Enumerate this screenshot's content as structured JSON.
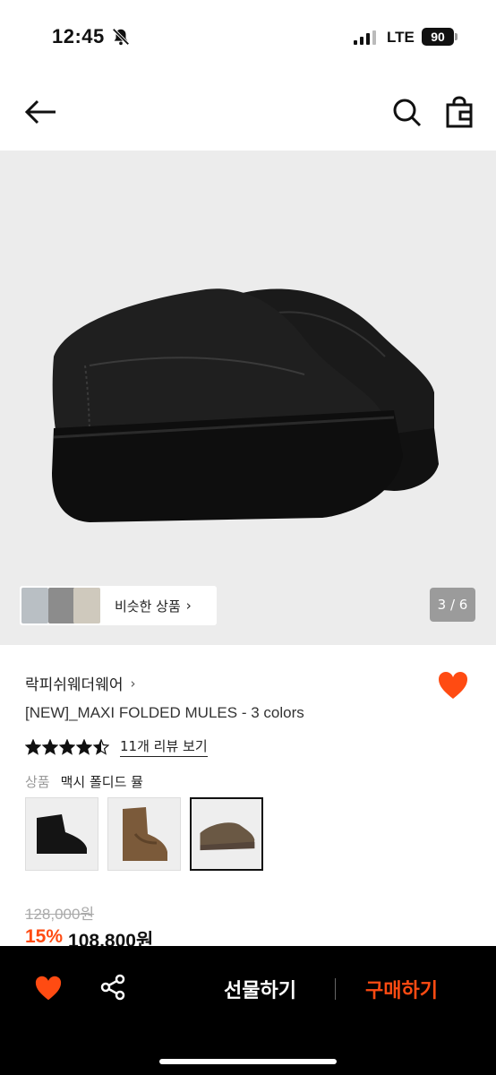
{
  "status_bar": {
    "time": "12:45",
    "network": "LTE",
    "battery": "90"
  },
  "gallery": {
    "similar_label": "비슷한 상품",
    "page_indicator": "3 / 6"
  },
  "product": {
    "brand": "락피쉬웨더웨어",
    "title": "[NEW]_MAXI FOLDED MULES - 3 colors",
    "rating": 4.5,
    "review_link": "11개 리뷰 보기",
    "option_key": "상품",
    "option_value": "맥시 폴디드 뮬",
    "original_price": "128,000원",
    "discount": "15%",
    "sale_price": "108,800원"
  },
  "bottom_bar": {
    "gift_label": "선물하기",
    "buy_label": "구매하기"
  },
  "colors": {
    "accent": "#ff4b12",
    "bottom_bar": "#000000"
  }
}
